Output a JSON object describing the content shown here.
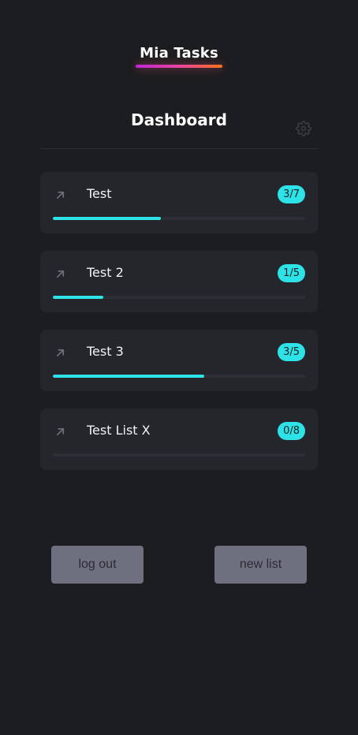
{
  "app": {
    "title": "Mia Tasks"
  },
  "header": {
    "title": "Dashboard",
    "settings_icon": "gear-icon"
  },
  "colors": {
    "background": "#1c1d21",
    "card": "#25262c",
    "accent": "#2ee3e8",
    "button": "#6e7080",
    "underline_gradient": [
      "#c026d3",
      "#ec4899",
      "#f97316"
    ]
  },
  "lists": [
    {
      "name": "Test",
      "done": 3,
      "total": 7,
      "badge": "3/7",
      "icon": "arrow-up-right-icon"
    },
    {
      "name": "Test 2",
      "done": 1,
      "total": 5,
      "badge": "1/5",
      "icon": "arrow-up-right-icon"
    },
    {
      "name": "Test 3",
      "done": 3,
      "total": 5,
      "badge": "3/5",
      "icon": "arrow-up-right-icon"
    },
    {
      "name": "Test List X",
      "done": 0,
      "total": 8,
      "badge": "0/8",
      "icon": "arrow-up-right-icon"
    }
  ],
  "actions": {
    "logout_label": "log out",
    "new_list_label": "new list"
  }
}
